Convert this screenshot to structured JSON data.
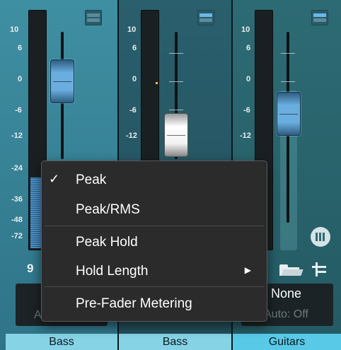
{
  "channels": [
    {
      "name": "Bass",
      "number": "9",
      "auto_label": "A"
    },
    {
      "name": "Bass"
    },
    {
      "name": "Guitars",
      "input": "None",
      "auto": "Auto: Off"
    }
  ],
  "scale": [
    "10",
    "6",
    "0",
    "-6",
    "-12",
    "-24",
    "-36",
    "-48",
    "-72"
  ],
  "menu": {
    "items": [
      {
        "label": "Peak",
        "checked": true
      },
      {
        "label": "Peak/RMS",
        "checked": false
      },
      {
        "label": "Peak Hold",
        "checked": false
      },
      {
        "label": "Hold Length",
        "submenu": true
      },
      {
        "label": "Pre-Fader Metering",
        "checked": false
      }
    ],
    "check_glyph": "✓",
    "arrow_glyph": "▶"
  },
  "colors": {
    "accent_blue": "#6aaee0",
    "selected_tab": "#59c9e8",
    "tab": "#8fd4e4"
  },
  "icons": [
    "view-toggle-icon",
    "mixer-icon",
    "meter-icon",
    "folder-open-icon",
    "routing-icon"
  ]
}
